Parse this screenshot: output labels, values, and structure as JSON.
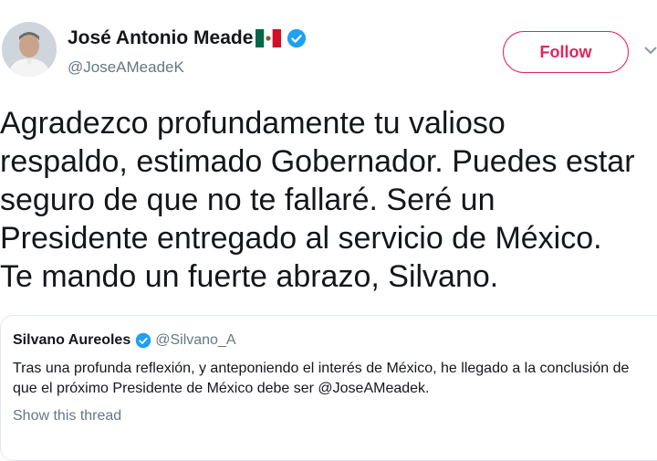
{
  "author": {
    "name": "José Antonio Meade",
    "handle": "@JoseAMeadeK",
    "avatar_icon": "profile-photo",
    "flag_icon": "mexico-flag-emoji",
    "verified_icon": "verified-badge-icon"
  },
  "follow_button": {
    "label": "Follow",
    "color": "#e0245e"
  },
  "tweet": {
    "text": "Agradezco profundamente tu valioso\nrespaldo, estimado Gobernador. Puedes estar\nseguro de que no te fallaré. Seré un\nPresidente entregado al servicio de México.\nTe mando un fuerte abrazo, Silvano."
  },
  "quoted_tweet": {
    "name": "Silvano Aureoles",
    "handle": "@Silvano_A",
    "text": "Tras una profunda reflexión, y anteponiendo el interés de México, he llegado a la conclusión de que el próximo Presidente de México debe ser @JoseAMeadek.",
    "show_thread": "Show this thread"
  },
  "colors": {
    "verified_blue": "#1da1f2",
    "secondary_text": "#657786",
    "border": "#e1e8ed"
  }
}
